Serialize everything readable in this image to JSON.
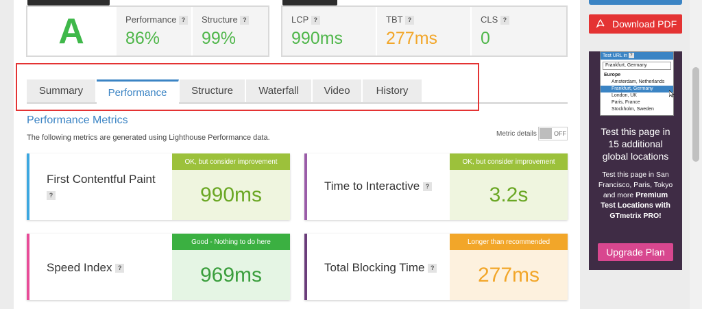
{
  "grade": {
    "letter": "A",
    "items": [
      {
        "label": "Performance",
        "value": "86%"
      },
      {
        "label": "Structure",
        "value": "99%"
      }
    ]
  },
  "vitals": [
    {
      "label": "LCP",
      "value": "990ms"
    },
    {
      "label": "TBT",
      "value": "277ms"
    },
    {
      "label": "CLS",
      "value": "0"
    }
  ],
  "help_mark": "?",
  "tabs": [
    "Summary",
    "Performance",
    "Structure",
    "Waterfall",
    "Video",
    "History"
  ],
  "active_tab": "Performance",
  "metrics_section": {
    "title": "Performance Metrics",
    "description": "The following metrics are generated using Lighthouse Performance data.",
    "details_label": "Metric details",
    "toggle_state": "OFF"
  },
  "metrics": [
    {
      "name": "First Contentful Paint",
      "status": "OK, but consider improvement",
      "value": "990ms",
      "bar_color": "#3ca7e0",
      "status_color": "#9cc13b",
      "value_bg": "#eff5df",
      "value_color": "#6aa724"
    },
    {
      "name": "Time to Interactive",
      "status": "OK, but consider improvement",
      "value": "3.2s",
      "bar_color": "#9a5ca8",
      "status_color": "#9cc13b",
      "value_bg": "#eff5df",
      "value_color": "#6aa724"
    },
    {
      "name": "Speed Index",
      "status": "Good - Nothing to do here",
      "value": "969ms",
      "bar_color": "#e84c98",
      "status_color": "#3bb041",
      "value_bg": "#e5f5e4",
      "value_color": "#3a9e3c"
    },
    {
      "name": "Total Blocking Time",
      "status": "Longer than recommended",
      "value": "277ms",
      "bar_color": "#6a3d7a",
      "status_color": "#f2a629",
      "value_bg": "#fdf1de",
      "value_color": "#f2a629"
    }
  ],
  "sidebar": {
    "download_pdf": "Download PDF",
    "mini": {
      "header": "Test URL in",
      "selected": "Frankfurt, Germany",
      "group": "Europe",
      "options": [
        "Amsterdam, Netherlands",
        "Frankfurt, Germany",
        "London, UK",
        "Paris, France",
        "Stockholm, Sweden"
      ]
    },
    "promo_heading": "Test this page in 15 additional global locations",
    "promo_text": "Test this page in San Francisco, Paris, Tokyo and more",
    "promo_bold": "Premium Test Locations with",
    "promo_brand": "GTmetrix PRO!",
    "upgrade_label": "Upgrade Plan"
  },
  "colors": {
    "accent": "#3b84c4",
    "highlight_box": "#e43333",
    "green": "#4fb64a",
    "orange": "#f2a629"
  }
}
